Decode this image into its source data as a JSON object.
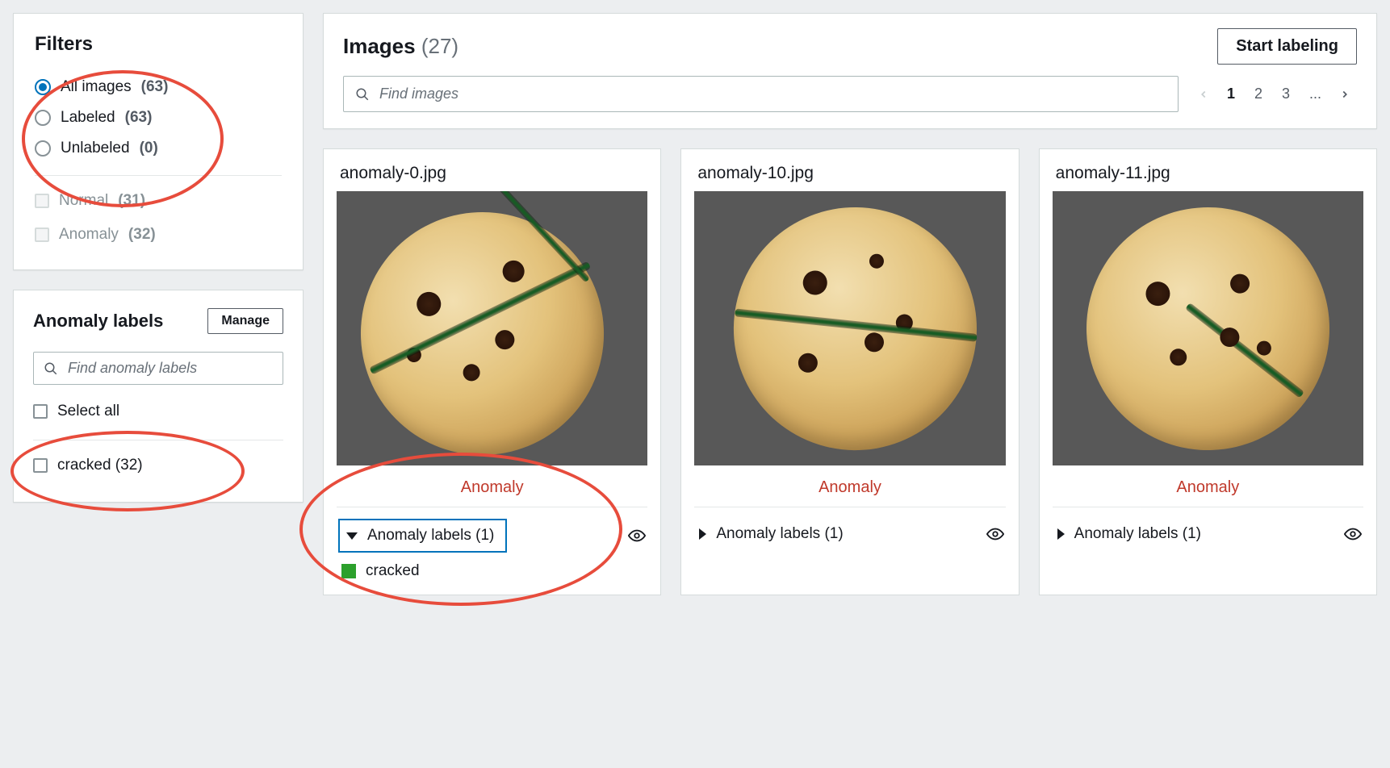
{
  "filters": {
    "title": "Filters",
    "radios": [
      {
        "label": "All images",
        "count": "(63)",
        "checked": true
      },
      {
        "label": "Labeled",
        "count": "(63)",
        "checked": false
      },
      {
        "label": "Unlabeled",
        "count": "(0)",
        "checked": false
      }
    ],
    "class_checks": [
      {
        "label": "Normal",
        "count": "(31)"
      },
      {
        "label": "Anomaly",
        "count": "(32)"
      }
    ]
  },
  "anomaly_panel": {
    "title": "Anomaly labels",
    "manage_label": "Manage",
    "search_placeholder": "Find anomaly labels",
    "select_all_label": "Select all",
    "labels": [
      {
        "label": "cracked (32)"
      }
    ]
  },
  "images_panel": {
    "title": "Images",
    "count": "(27)",
    "start_labeling": "Start labeling",
    "search_placeholder": "Find images",
    "pages": [
      "1",
      "2",
      "3",
      "..."
    ],
    "current_page": "1"
  },
  "cards": [
    {
      "filename": "anomaly-0.jpg",
      "tag": "Anomaly",
      "labels_header": "Anomaly labels (1)",
      "open": true,
      "labels": [
        {
          "name": "cracked",
          "color": "#2ca02c"
        }
      ]
    },
    {
      "filename": "anomaly-10.jpg",
      "tag": "Anomaly",
      "labels_header": "Anomaly labels (1)",
      "open": false
    },
    {
      "filename": "anomaly-11.jpg",
      "tag": "Anomaly",
      "labels_header": "Anomaly labels (1)",
      "open": false
    }
  ]
}
